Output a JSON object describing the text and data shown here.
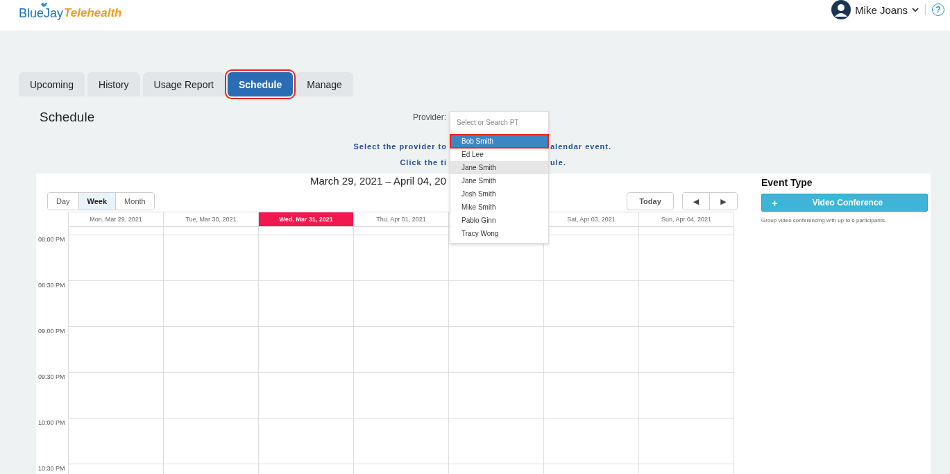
{
  "header": {
    "logo": {
      "part_1": "BlueJay",
      "part_2": "Telehealth"
    },
    "user": "Mike Joans",
    "help": "?"
  },
  "tabs": [
    {
      "label": "Upcoming",
      "selected": false,
      "highlighted": false
    },
    {
      "label": "History",
      "selected": false,
      "highlighted": false
    },
    {
      "label": "Usage Report",
      "selected": false,
      "highlighted": false
    },
    {
      "label": "Schedule",
      "selected": true,
      "highlighted": true
    },
    {
      "label": "Manage",
      "selected": false,
      "highlighted": false
    }
  ],
  "page_title": "Schedule",
  "provider": {
    "label": "Provider:",
    "placeholder": "Select or Search PT",
    "options": [
      {
        "label": "Bob Smith",
        "selected": true,
        "highlighted": true,
        "hovered": false
      },
      {
        "label": "Ed Lee",
        "selected": false,
        "highlighted": false,
        "hovered": false
      },
      {
        "label": "Jane Smith",
        "selected": false,
        "highlighted": false,
        "hovered": true
      },
      {
        "label": "Jane Smith",
        "selected": false,
        "highlighted": false,
        "hovered": false
      },
      {
        "label": "Josh Smith",
        "selected": false,
        "highlighted": false,
        "hovered": false
      },
      {
        "label": "Mike Smith",
        "selected": false,
        "highlighted": false,
        "hovered": false
      },
      {
        "label": "Pablo Ginn",
        "selected": false,
        "highlighted": false,
        "hovered": false
      },
      {
        "label": "Tracy Wong",
        "selected": false,
        "highlighted": false,
        "hovered": false
      }
    ]
  },
  "instructions": [
    {
      "before": "Select the provider to",
      "after": "alendar event."
    },
    {
      "before": "Click the ti",
      "after": "ule."
    }
  ],
  "calendar": {
    "title": "March 29, 2021 – April 04, 20",
    "views": [
      {
        "label": "Day",
        "selected": false
      },
      {
        "label": "Week",
        "selected": true
      },
      {
        "label": "Month",
        "selected": false
      }
    ],
    "today": "Today",
    "prev": "◀",
    "next": "▶",
    "days": [
      {
        "label": "Mon, Mar 29, 2021",
        "today": false
      },
      {
        "label": "Tue, Mar 30, 2021",
        "today": false
      },
      {
        "label": "Wed, Mar 31, 2021",
        "today": true
      },
      {
        "label": "Thu, Apr 01, 2021",
        "today": false
      },
      {
        "today": false
      },
      {
        "label": "Sat, Apr 03, 2021",
        "today": false
      },
      {
        "label": "Sun, Apr 04, 2021",
        "today": false
      }
    ],
    "times": [
      "08:00 PM",
      "08:30 PM",
      "09:00 PM",
      "09:30 PM",
      "10:00 PM",
      "10:30 PM"
    ]
  },
  "event_type": {
    "title": "Event Type",
    "button": {
      "icon": "+",
      "label": "Video Conference"
    },
    "description": "Group video conferencing with up to 6 participants."
  }
}
